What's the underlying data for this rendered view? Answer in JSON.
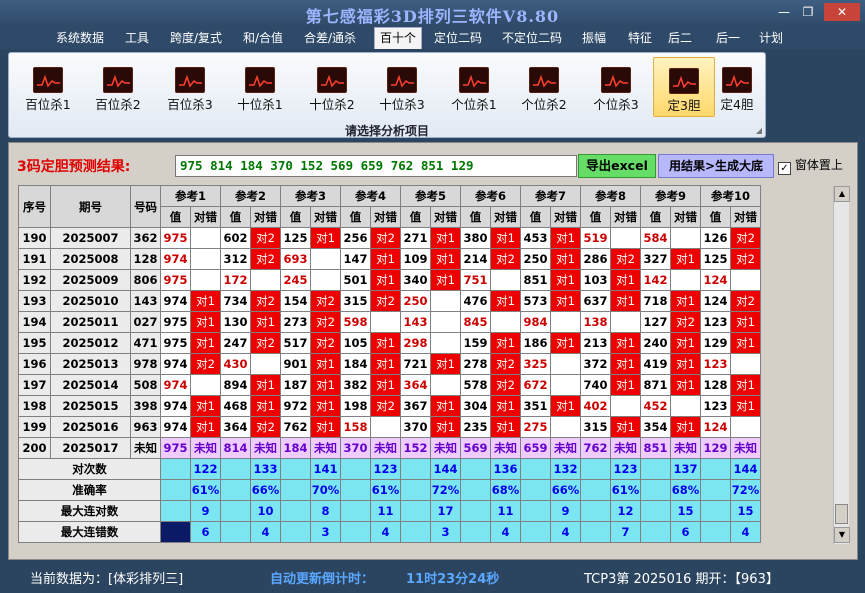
{
  "window": {
    "title": "第七感福彩3D排列三软件V8.80",
    "min": "—",
    "max": "❐",
    "close": "✕"
  },
  "menu": [
    "系统数据",
    "工具",
    "跨度/复式",
    "和/合值",
    "合差/通杀",
    "百十个",
    "定位二码",
    "不定位二码",
    "振幅",
    "特征",
    "后二",
    "后一",
    "计划"
  ],
  "menu_active_index": 5,
  "ribbon": {
    "buttons": [
      "百位杀1",
      "百位杀2",
      "百位杀3",
      "十位杀1",
      "十位杀2",
      "十位杀3",
      "个位杀1",
      "个位杀2",
      "个位杀3",
      "定3胆",
      "定4胆"
    ],
    "selected_index": 9,
    "caption": "请选择分析项目",
    "icon": "chart-icon"
  },
  "prediction": {
    "label": "3码定胆预测结果:",
    "value": "975 814 184 370 152 569 659 762 851 129",
    "export_label": "导出excel",
    "generate_label": "用结果>生成大底",
    "ontop_label": "窗体置上",
    "ontop_checked": "✓"
  },
  "table": {
    "headers": {
      "seq": "序号",
      "period": "期号",
      "number": "号码",
      "value": "值",
      "right_wrong": "对错"
    },
    "ref_headers": [
      "参考1",
      "参考2",
      "参考3",
      "参考4",
      "参考5",
      "参考6",
      "参考7",
      "参考8",
      "参考9",
      "参考10"
    ],
    "rows": [
      {
        "seq": "190",
        "period": "2025007",
        "num": "362",
        "cells": [
          [
            "975",
            "",
            0
          ],
          [
            "602",
            "对2",
            1
          ],
          [
            "125",
            "对1",
            1
          ],
          [
            "256",
            "对2",
            1
          ],
          [
            "271",
            "对1",
            1
          ],
          [
            "380",
            "对1",
            1
          ],
          [
            "453",
            "对1",
            1
          ],
          [
            "519",
            "",
            0
          ],
          [
            "584",
            "",
            0
          ],
          [
            "126",
            "对2",
            1
          ]
        ]
      },
      {
        "seq": "191",
        "period": "2025008",
        "num": "128",
        "cells": [
          [
            "974",
            "",
            0
          ],
          [
            "312",
            "对2",
            1
          ],
          [
            "693",
            "",
            0
          ],
          [
            "147",
            "对1",
            1
          ],
          [
            "109",
            "对1",
            1
          ],
          [
            "214",
            "对2",
            1
          ],
          [
            "250",
            "对1",
            1
          ],
          [
            "286",
            "对2",
            1
          ],
          [
            "327",
            "对1",
            1
          ],
          [
            "125",
            "对2",
            1
          ]
        ]
      },
      {
        "seq": "192",
        "period": "2025009",
        "num": "806",
        "cells": [
          [
            "975",
            "",
            0
          ],
          [
            "172",
            "",
            0
          ],
          [
            "245",
            "",
            0
          ],
          [
            "501",
            "对1",
            1
          ],
          [
            "340",
            "对1",
            1
          ],
          [
            "751",
            "",
            0
          ],
          [
            "851",
            "对1",
            1
          ],
          [
            "103",
            "对1",
            1
          ],
          [
            "142",
            "",
            0
          ],
          [
            "124",
            "",
            0
          ]
        ]
      },
      {
        "seq": "193",
        "period": "2025010",
        "num": "143",
        "cells": [
          [
            "974",
            "对1",
            1
          ],
          [
            "734",
            "对2",
            1
          ],
          [
            "154",
            "对2",
            1
          ],
          [
            "315",
            "对2",
            1
          ],
          [
            "250",
            "",
            0
          ],
          [
            "476",
            "对1",
            1
          ],
          [
            "573",
            "对1",
            1
          ],
          [
            "637",
            "对1",
            1
          ],
          [
            "718",
            "对1",
            1
          ],
          [
            "124",
            "对2",
            1
          ]
        ]
      },
      {
        "seq": "194",
        "period": "2025011",
        "num": "027",
        "cells": [
          [
            "975",
            "对1",
            1
          ],
          [
            "130",
            "对1",
            1
          ],
          [
            "273",
            "对2",
            1
          ],
          [
            "598",
            "",
            0
          ],
          [
            "143",
            "",
            0
          ],
          [
            "845",
            "",
            0
          ],
          [
            "984",
            "",
            0
          ],
          [
            "138",
            "",
            0
          ],
          [
            "127",
            "对2",
            1
          ],
          [
            "123",
            "对1",
            1
          ]
        ]
      },
      {
        "seq": "195",
        "period": "2025012",
        "num": "471",
        "cells": [
          [
            "975",
            "对1",
            1
          ],
          [
            "247",
            "对2",
            1
          ],
          [
            "517",
            "对2",
            1
          ],
          [
            "105",
            "对1",
            1
          ],
          [
            "298",
            "",
            0
          ],
          [
            "159",
            "对1",
            1
          ],
          [
            "186",
            "对1",
            1
          ],
          [
            "213",
            "对1",
            1
          ],
          [
            "240",
            "对1",
            1
          ],
          [
            "129",
            "对1",
            1
          ]
        ]
      },
      {
        "seq": "196",
        "period": "2025013",
        "num": "978",
        "cells": [
          [
            "974",
            "对2",
            1
          ],
          [
            "430",
            "",
            0
          ],
          [
            "901",
            "对1",
            1
          ],
          [
            "184",
            "对1",
            1
          ],
          [
            "721",
            "对1",
            1
          ],
          [
            "278",
            "对2",
            1
          ],
          [
            "325",
            "",
            0
          ],
          [
            "372",
            "对1",
            1
          ],
          [
            "419",
            "对1",
            1
          ],
          [
            "123",
            "",
            0
          ]
        ]
      },
      {
        "seq": "197",
        "period": "2025014",
        "num": "508",
        "cells": [
          [
            "974",
            "",
            0
          ],
          [
            "894",
            "对1",
            1
          ],
          [
            "187",
            "对1",
            1
          ],
          [
            "382",
            "对1",
            1
          ],
          [
            "364",
            "",
            0
          ],
          [
            "578",
            "对2",
            1
          ],
          [
            "672",
            "",
            0
          ],
          [
            "740",
            "对1",
            1
          ],
          [
            "871",
            "对1",
            1
          ],
          [
            "128",
            "对1",
            1
          ]
        ]
      },
      {
        "seq": "198",
        "period": "2025015",
        "num": "398",
        "cells": [
          [
            "974",
            "对1",
            1
          ],
          [
            "468",
            "对1",
            1
          ],
          [
            "972",
            "对1",
            1
          ],
          [
            "198",
            "对2",
            1
          ],
          [
            "367",
            "对1",
            1
          ],
          [
            "304",
            "对1",
            1
          ],
          [
            "351",
            "对1",
            1
          ],
          [
            "402",
            "",
            0
          ],
          [
            "452",
            "",
            0
          ],
          [
            "123",
            "对1",
            1
          ]
        ]
      },
      {
        "seq": "199",
        "period": "2025016",
        "num": "963",
        "cells": [
          [
            "974",
            "对1",
            1
          ],
          [
            "364",
            "对2",
            1
          ],
          [
            "762",
            "对1",
            1
          ],
          [
            "158",
            "",
            0
          ],
          [
            "370",
            "对1",
            1
          ],
          [
            "235",
            "对1",
            1
          ],
          [
            "275",
            "",
            0
          ],
          [
            "315",
            "对1",
            1
          ],
          [
            "354",
            "对1",
            1
          ],
          [
            "124",
            "",
            0
          ]
        ]
      }
    ],
    "bottom_row": {
      "seq": "200",
      "period": "2025017",
      "num": "未知",
      "values": [
        "975",
        "814",
        "184",
        "370",
        "152",
        "569",
        "659",
        "762",
        "851",
        "129"
      ],
      "status": "未知"
    },
    "stats": [
      {
        "label": "对次数",
        "values": [
          "122",
          "133",
          "141",
          "123",
          "144",
          "136",
          "132",
          "123",
          "137",
          "144"
        ]
      },
      {
        "label": "准确率",
        "values": [
          "61%",
          "66%",
          "70%",
          "61%",
          "72%",
          "68%",
          "66%",
          "61%",
          "68%",
          "72%"
        ]
      },
      {
        "label": "最大连对数",
        "values": [
          "9",
          "10",
          "8",
          "11",
          "17",
          "11",
          "9",
          "12",
          "15",
          "15"
        ]
      },
      {
        "label": "最大连错数",
        "values": [
          "6",
          "4",
          "3",
          "4",
          "3",
          "4",
          "4",
          "7",
          "6",
          "4"
        ]
      }
    ]
  },
  "status": {
    "current_data": "当前数据为：[体彩排列三]",
    "countdown_label": "自动更新倒计时：",
    "countdown_value": "11时23分24秒",
    "draw": "TCP3第 2025016 期开：【963】"
  },
  "colors": {
    "hit": "#ee0000",
    "value_red": "#cc0000",
    "stat_bg": "#7be6f2",
    "stat_text": "#0000ee",
    "bottom_bg": "#eeccff",
    "bottom_text": "#6600cc",
    "prediction_text": "#007700"
  }
}
